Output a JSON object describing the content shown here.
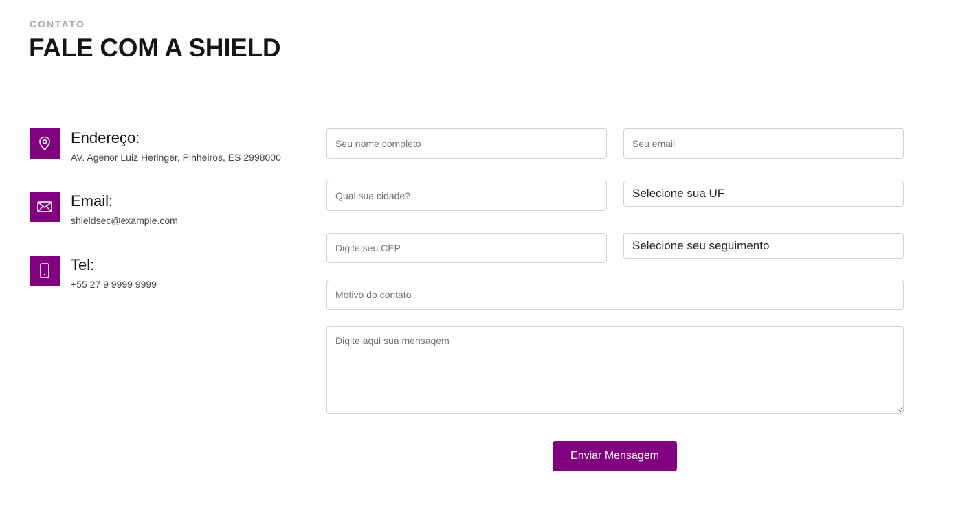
{
  "header": {
    "eyebrow": "CONTATO",
    "title": "FALE COM A SHIELD"
  },
  "contact_info": {
    "address": {
      "icon": "map-pin-icon",
      "title": "Endereço:",
      "text": "AV. Agenor Luiz Heringer, Pinheiros, ES 2998000"
    },
    "email": {
      "icon": "envelope-icon",
      "title": "Email:",
      "text": "shieldsec@example.com"
    },
    "phone": {
      "icon": "phone-icon",
      "title": "Tel:",
      "text": "+55 27 9 9999 9999"
    }
  },
  "form": {
    "name_placeholder": "Seu nome completo",
    "email_placeholder": "Seu email",
    "city_placeholder": "Qual sua cidade?",
    "uf_select": "Selecione sua UF",
    "cep_placeholder": "Digite seu CEP",
    "segment_select": "Selecione seu seguimento",
    "reason_placeholder": "Motivo do contato",
    "message_placeholder": "Digite aqui sua mensagem",
    "submit_label": "Enviar Mensagem"
  },
  "colors": {
    "accent": "#800080",
    "title": "#151515",
    "eyebrow_line": "#f0e6b5"
  }
}
